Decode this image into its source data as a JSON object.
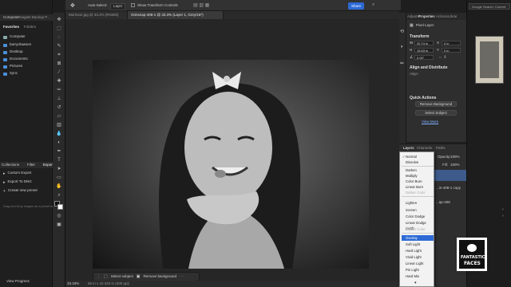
{
  "options_bar": {
    "auto_select_label": "Auto-Select:",
    "auto_select_value": "Layer",
    "transform_controls_label": "Show Transform Controls",
    "share_label": "Share"
  },
  "doc_tabs": [
    {
      "label": "Morrison.jpg @ 33.3% (RGB/8)"
    },
    {
      "label": "Grinsnap-408-1 @ 33.3% (Layer 1, Grey/16*)"
    }
  ],
  "left_panel": {
    "top_tabs": [
      "Computer",
      "Seagate Backup P..."
    ],
    "section_tabs": [
      "Favorites",
      "Folders"
    ],
    "favorites": [
      "Computer",
      "barrydrawsen",
      "Desktop",
      "Documents",
      "Pictures",
      "Sync"
    ],
    "bottom_tabs": [
      "Collections",
      "Filter",
      "Export"
    ],
    "export_items": [
      "Custom Export",
      "Export To DNG",
      "Create new preset"
    ],
    "drop_hint": "Drag and Drop images as a preset to your",
    "view_progress": "View Progress"
  },
  "status": {
    "zoom": "33.33%",
    "doc_info": "56 in x 16.333 in (300 ppi)"
  },
  "taskbar": {
    "select_subject": "Select subject",
    "remove_background": "Remove background"
  },
  "properties": {
    "tabs": [
      "Adjustm",
      "Properties",
      "Actions",
      "Librar"
    ],
    "pixel_layer_label": "Pixel Layer",
    "transform_title": "Transform",
    "w_value": "32.74 in",
    "h_value": "15.63 in",
    "x_value": "0 in",
    "y_value": "0 in",
    "angle_value": "0.00°",
    "align_title": "Align and Distribute",
    "align_label": "Align:",
    "quick_actions_title": "Quick Actions",
    "remove_background_btn": "Remove Background",
    "select_subject_btn": "Select Subject",
    "view_more": "View More"
  },
  "layers": {
    "tabs": [
      "Layers",
      "Channels",
      "Paths"
    ],
    "opacity_label": "Opacity:",
    "opacity_value": "100%",
    "fill_label": "Fill:",
    "fill_value": "100%",
    "layer_names": [
      "...in-408-1 copy",
      "...ap-408"
    ]
  },
  "blend_menu": {
    "items": [
      "Normal",
      "Dissolve",
      "Darken",
      "Multiply",
      "Color Burn",
      "Linear Burn",
      "Darker Color",
      "Lighten",
      "Screen",
      "Color Dodge",
      "Linear Dodge (Add)",
      "Lighter Color",
      "Overlay",
      "Soft Light",
      "Hard Light",
      "Vivid Light",
      "Linear Light",
      "Pin Light",
      "Hard Mix"
    ],
    "selected": "Overlay",
    "disabled": [
      "Darker Color",
      "Lighter Color"
    ]
  },
  "far_right": {
    "search_placeholder": "Google Search: Current"
  },
  "logo": {
    "line1": "FANTASTIC",
    "line2": "FACES"
  },
  "colors": {
    "accent": "#2d6ad6",
    "panel": "#2e2e2e",
    "canvas": "#262626"
  }
}
